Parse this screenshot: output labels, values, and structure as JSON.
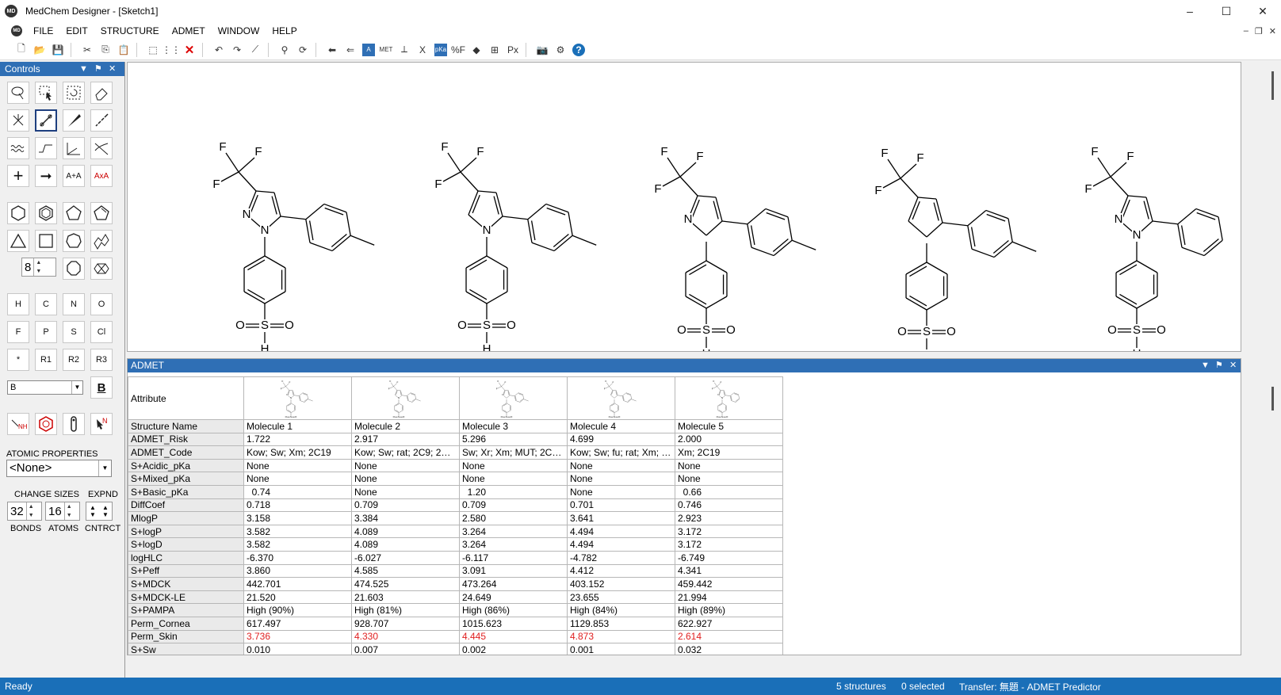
{
  "window": {
    "title": "MedChem Designer - [Sketch1]",
    "logo_text": "MD"
  },
  "menu": [
    "FILE",
    "EDIT",
    "STRUCTURE",
    "ADMET",
    "WINDOW",
    "HELP"
  ],
  "toolbar": {
    "items": [
      {
        "name": "new-file-icon",
        "glyph": "🗋"
      },
      {
        "name": "open-folder-icon",
        "glyph": "📂"
      },
      {
        "name": "save-icon",
        "glyph": "💾"
      },
      {
        "sep": true
      },
      {
        "name": "cut-icon",
        "glyph": "✂"
      },
      {
        "name": "copy-icon",
        "glyph": "⎘"
      },
      {
        "name": "paste-icon",
        "glyph": "📋"
      },
      {
        "sep": true
      },
      {
        "name": "select-all-icon",
        "glyph": "⬚"
      },
      {
        "name": "grid-select-icon",
        "glyph": "⋮⋮"
      },
      {
        "name": "delete-icon",
        "glyph": "✕"
      },
      {
        "sep": true
      },
      {
        "name": "undo-icon",
        "glyph": "↶"
      },
      {
        "name": "redo-icon",
        "glyph": "↷"
      },
      {
        "name": "clean-structure-icon",
        "glyph": "⟋"
      },
      {
        "sep": true
      },
      {
        "name": "structure-search-icon",
        "glyph": "⚲"
      },
      {
        "name": "refresh-icon",
        "glyph": "⟳"
      },
      {
        "sep": true
      },
      {
        "name": "import-arrow-icon",
        "glyph": "⬅"
      },
      {
        "name": "export-arrow-icon",
        "glyph": "⇐"
      },
      {
        "name": "admet-icon",
        "glyph": "A"
      },
      {
        "name": "met-icon",
        "glyph": "MET"
      },
      {
        "name": "tree-icon",
        "glyph": "⟂"
      },
      {
        "name": "x-atom-icon",
        "glyph": "X"
      },
      {
        "name": "pka-icon",
        "glyph": "pKa"
      },
      {
        "name": "percent-f-icon",
        "glyph": "%F"
      },
      {
        "name": "eraser-icon",
        "glyph": "◆"
      },
      {
        "name": "plot-icon",
        "glyph": "⊞"
      },
      {
        "name": "px-icon",
        "glyph": "Px"
      },
      {
        "sep": true
      },
      {
        "name": "camera-icon",
        "glyph": "📷"
      },
      {
        "name": "settings-gear-icon",
        "glyph": "⚙"
      },
      {
        "name": "help-icon",
        "glyph": "?"
      }
    ]
  },
  "controls": {
    "title": "Controls",
    "element_buttons": [
      "H",
      "C",
      "N",
      "O",
      "F",
      "P",
      "S",
      "Cl",
      "*",
      "R1",
      "R2",
      "R3"
    ],
    "ring_size_value": "8",
    "font_select": "B",
    "bold_label": "B",
    "atomic_properties_label": "ATOMIC PROPERTIES",
    "atomic_properties_value": "<None>",
    "change_sizes_label": "CHANGE SIZES",
    "expnd_label": "EXPND",
    "bonds_value": "32",
    "atoms_value": "16",
    "bonds_label": "BONDS",
    "atoms_label": "ATOMS",
    "cntrct_label": "CNTRCT"
  },
  "molecules": [
    {
      "id": 1,
      "ring": "pyrazole",
      "para_methyl": true
    },
    {
      "id": 2,
      "ring": "pyrrole",
      "para_methyl": true
    },
    {
      "id": 3,
      "ring": "pyrroline",
      "para_methyl": true
    },
    {
      "id": 4,
      "ring": "cyclopentadiene",
      "para_methyl": true
    },
    {
      "id": 5,
      "ring": "pyrazole",
      "para_methyl": false
    }
  ],
  "admet": {
    "title": "ADMET",
    "attr_header": "Attribute",
    "rows": [
      {
        "attr": "Structure Name",
        "values": [
          "Molecule 1",
          "Molecule 2",
          "Molecule 3",
          "Molecule 4",
          "Molecule 5"
        ]
      },
      {
        "attr": "ADMET_Risk",
        "values": [
          "1.722",
          "2.917",
          "5.296",
          "4.699",
          "2.000"
        ]
      },
      {
        "attr": "ADMET_Code",
        "values": [
          "Kow; Sw; Xm; 2C19",
          "Kow; Sw; rat; 2C9; 2C19",
          "Sw; Xr; Xm; MUT; 2C9; 2...",
          "Kow; Sw; fu; rat; Xm; 2C...",
          "Xm; 2C19"
        ]
      },
      {
        "attr": "S+Acidic_pKa",
        "values": [
          "None",
          "None",
          "None",
          "None",
          "None"
        ]
      },
      {
        "attr": "S+Mixed_pKa",
        "values": [
          "None",
          "None",
          "None",
          "None",
          "None"
        ]
      },
      {
        "attr": "S+Basic_pKa",
        "values": [
          "  0.74",
          "None",
          "  1.20",
          "None",
          "  0.66"
        ]
      },
      {
        "attr": "DiffCoef",
        "values": [
          "0.718",
          "0.709",
          "0.709",
          "0.701",
          "0.746"
        ]
      },
      {
        "attr": "MlogP",
        "values": [
          "3.158",
          "3.384",
          "2.580",
          "3.641",
          "2.923"
        ]
      },
      {
        "attr": "S+logP",
        "values": [
          "3.582",
          "4.089",
          "3.264",
          "4.494",
          "3.172"
        ]
      },
      {
        "attr": "S+logD",
        "values": [
          "3.582",
          "4.089",
          "3.264",
          "4.494",
          "3.172"
        ]
      },
      {
        "attr": "logHLC",
        "values": [
          "-6.370",
          "-6.027",
          "-6.117",
          "-4.782",
          "-6.749"
        ]
      },
      {
        "attr": "S+Peff",
        "values": [
          "3.860",
          "4.585",
          "3.091",
          "4.412",
          "4.341"
        ]
      },
      {
        "attr": "S+MDCK",
        "values": [
          "442.701",
          "474.525",
          "473.264",
          "403.152",
          "459.442"
        ]
      },
      {
        "attr": "S+MDCK-LE",
        "values": [
          "21.520",
          "21.603",
          "24.649",
          "23.655",
          "21.994"
        ]
      },
      {
        "attr": "S+PAMPA",
        "values": [
          "High (90%)",
          "High (81%)",
          "High (86%)",
          "High (84%)",
          "High (89%)"
        ]
      },
      {
        "attr": "Perm_Cornea",
        "values": [
          "617.497",
          "928.707",
          "1015.623",
          "1129.853",
          "622.927"
        ]
      },
      {
        "attr": "Perm_Skin",
        "values": [
          "3.736",
          "4.330",
          "4.445",
          "4.873",
          "2.614"
        ],
        "highlight": "#e02020"
      },
      {
        "attr": "S+Sw",
        "values": [
          "0.010",
          "0.007",
          "0.002",
          "0.001",
          "0.032"
        ]
      }
    ]
  },
  "status": {
    "ready": "Ready",
    "structures": "5 structures",
    "selected": "0 selected",
    "transfer": "Transfer: 無題 - ADMET Predictor"
  },
  "colors": {
    "accent": "#2f6fb5",
    "status_bar": "#1a6fb8",
    "highlight_red": "#e02020"
  }
}
